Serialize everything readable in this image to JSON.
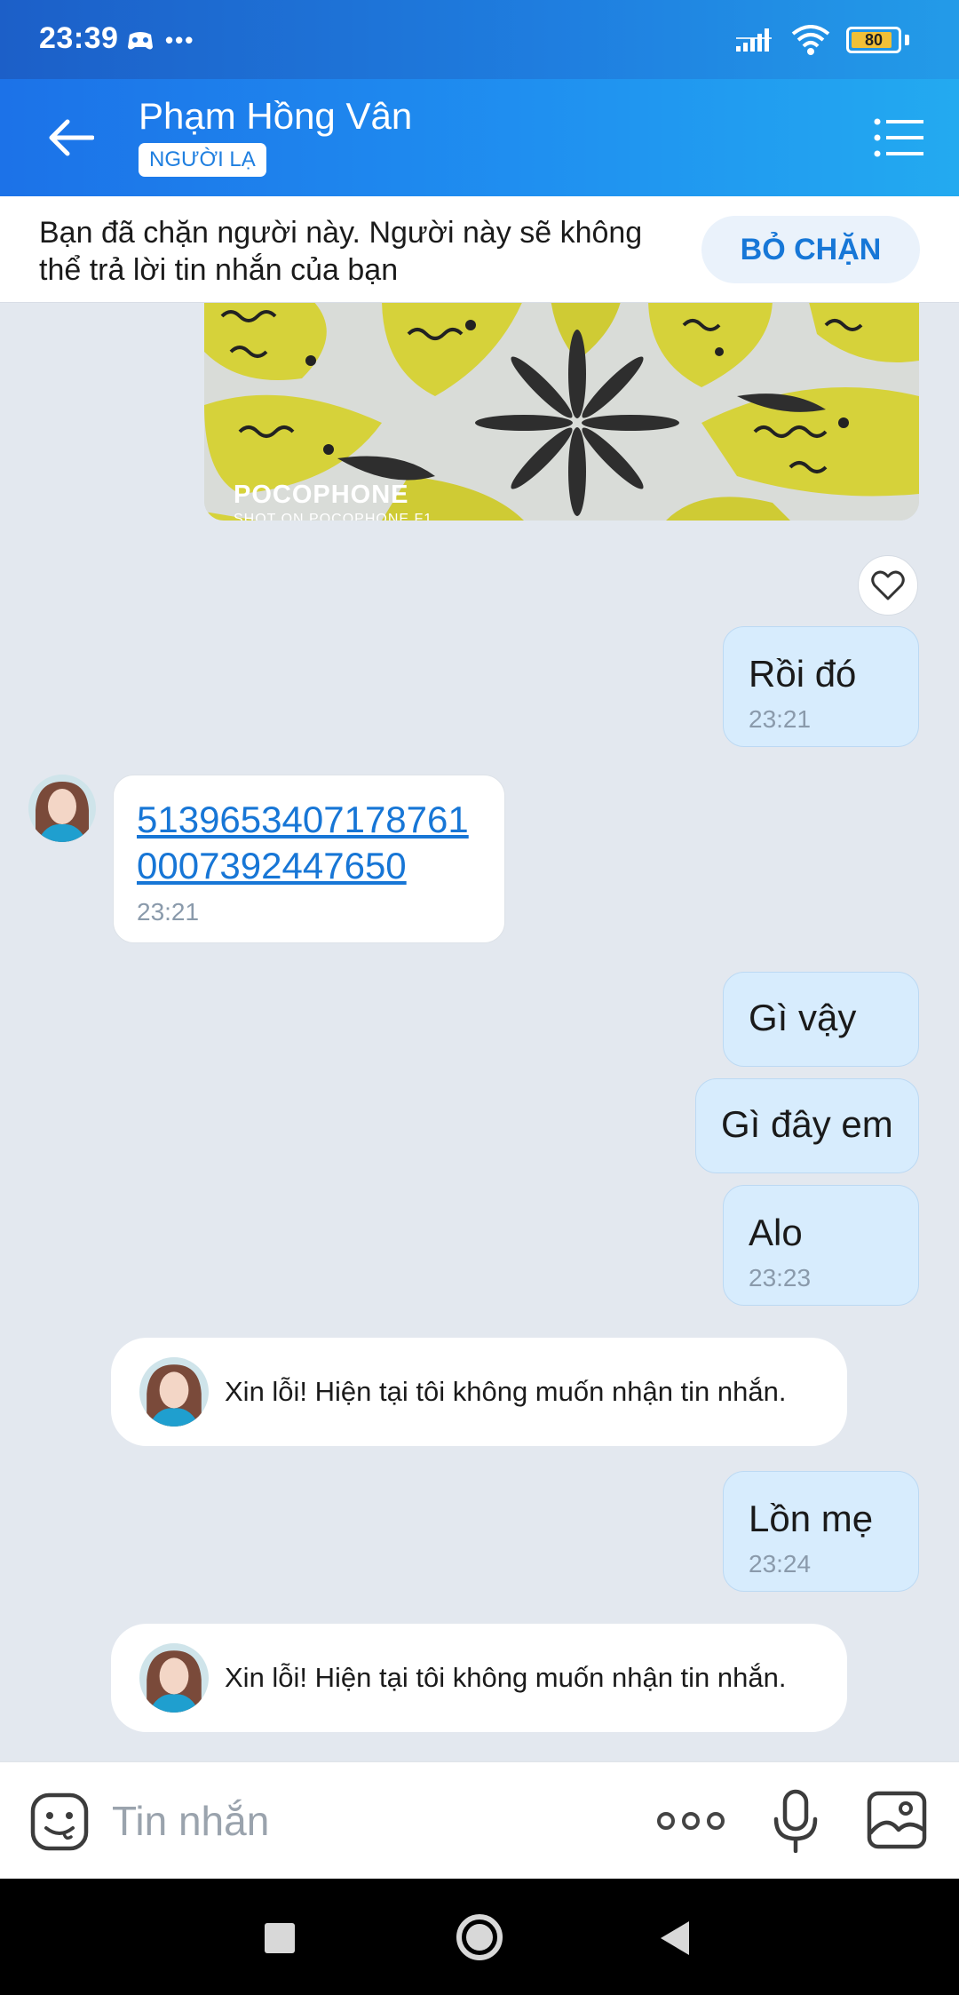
{
  "status_bar": {
    "time": "23:39",
    "dots": "•••",
    "battery": "80"
  },
  "header": {
    "contact_name": "Phạm Hồng Vân",
    "badge": "NGƯỜI LẠ"
  },
  "block_banner": {
    "text": "Bạn đã chặn người này. Người này sẽ không thể trả lời tin nhắn của bạn",
    "action_label": "BỎ CHẶN"
  },
  "photo": {
    "watermark_title": "POCOPHONE",
    "watermark_subtitle": "SHOT ON POCOPHONE F1"
  },
  "messages": [
    {
      "text": "Rồi đó",
      "time": "23:21"
    },
    {
      "text": "51396534071787610007392447650",
      "time": "23:21"
    },
    {
      "text": "Gì vậy"
    },
    {
      "text": "Gì đây em"
    },
    {
      "text": "Alo",
      "time": "23:23"
    },
    {
      "text": "Xin lỗi! Hiện tại tôi không muốn nhận tin nhắn."
    },
    {
      "text": "Lồn mẹ",
      "time": "23:24"
    },
    {
      "text": "Xin lỗi! Hiện tại tôi không muốn nhận tin nhắn."
    }
  ],
  "input": {
    "placeholder": "Tin nhắn"
  },
  "colors": {
    "header_gradient_start": "#1c72e8",
    "header_gradient_end": "#23aaf0",
    "outgoing_bubble": "#d7ecfd",
    "link": "#1776d6",
    "chat_background": "#e3e8ef"
  },
  "icons": [
    "back-arrow-icon",
    "menu-list-icon",
    "heart-icon",
    "emoji-icon",
    "more-icon",
    "mic-icon",
    "image-icon"
  ]
}
